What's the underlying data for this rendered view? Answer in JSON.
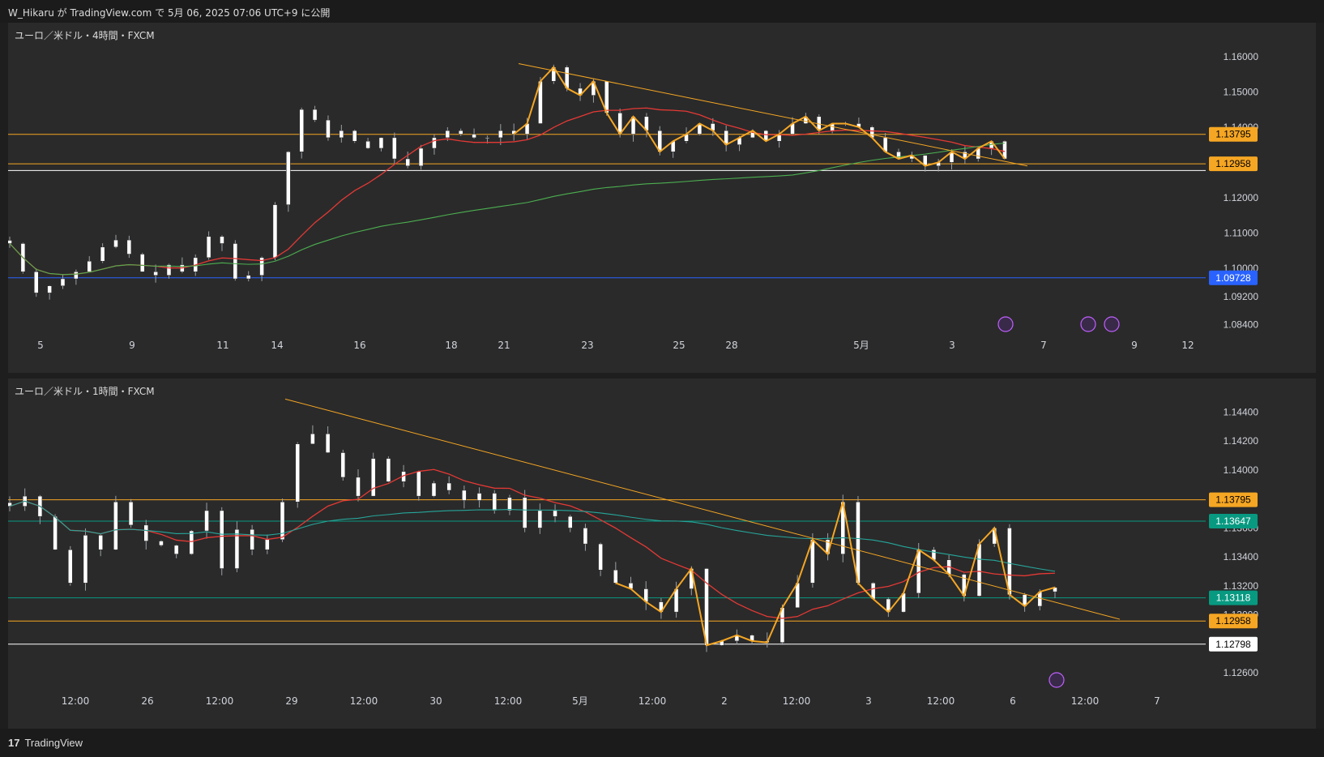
{
  "header": {
    "title": "W_Hikaru が TradingView.com で 5月 06, 2025 07:06 UTC+9 に公開"
  },
  "footer": {
    "brand": "TradingView",
    "logo_glyph": "17"
  },
  "colors": {
    "bg": "#2a2a2a",
    "up": "#ffffff",
    "down": "#ffffff",
    "wick": "#9aa0a6",
    "orange": "#f5a623",
    "red": "#e53935",
    "green": "#4caf50",
    "teal": "#26a69a",
    "blue": "#2962ff",
    "label_orange": "#f5a623",
    "label_teal": "#089981",
    "label_blue": "#2962ff",
    "label_white": "#ffffff"
  },
  "pane1": {
    "label": "ユーロ／米ドル・4時間・FXCM",
    "price_ticks": [
      "1.16000",
      "1.15000",
      "1.14000",
      "1.12000",
      "1.11000",
      "1.10000",
      "1.09200",
      "1.08400"
    ],
    "price_values": [
      1.16,
      1.15,
      1.14,
      1.12,
      1.11,
      1.1,
      1.092,
      1.084
    ],
    "time_ticks": [
      "5",
      "9",
      "11",
      "14",
      "16",
      "18",
      "21",
      "23",
      "25",
      "28",
      "5月",
      "3",
      "7",
      "9",
      "12"
    ],
    "levels": [
      {
        "price": 1.13795,
        "label": "1.13795",
        "color": "#f5a623",
        "textcolor": "#000000"
      },
      {
        "price": 1.12958,
        "label": "1.12958",
        "color": "#f5a623",
        "textcolor": "#000000"
      },
      {
        "price": 1.1277,
        "label": "",
        "color": "#ffffff",
        "textcolor": "#000000"
      },
      {
        "price": 1.09728,
        "label": "1.09728",
        "color": "#2962ff",
        "textcolor": "#ffffff"
      }
    ],
    "event_icons": [
      "lightning-icon",
      "us-flag-icon",
      "eu-flag-icon"
    ]
  },
  "pane2": {
    "label": "ユーロ／米ドル・1時間・FXCM",
    "price_ticks": [
      "1.14400",
      "1.14200",
      "1.14000",
      "1.13600",
      "1.13400",
      "1.13200",
      "1.13000",
      "1.12600"
    ],
    "price_values": [
      1.144,
      1.142,
      1.14,
      1.136,
      1.134,
      1.132,
      1.13,
      1.126
    ],
    "time_ticks": [
      "12:00",
      "26",
      "12:00",
      "29",
      "12:00",
      "30",
      "12:00",
      "5月",
      "12:00",
      "2",
      "12:00",
      "3",
      "12:00",
      "6",
      "12:00",
      "7"
    ],
    "levels": [
      {
        "price": 1.13795,
        "label": "1.13795",
        "color": "#f5a623",
        "textcolor": "#000000"
      },
      {
        "price": 1.13647,
        "label": "1.13647",
        "color": "#089981",
        "textcolor": "#ffffff"
      },
      {
        "price": 1.13118,
        "label": "1.13118",
        "color": "#089981",
        "textcolor": "#ffffff"
      },
      {
        "price": 1.12958,
        "label": "1.12958",
        "color": "#f5a623",
        "textcolor": "#000000"
      },
      {
        "price": 1.12798,
        "label": "1.12798",
        "color": "#ffffff",
        "textcolor": "#000000"
      }
    ],
    "event_icons": [
      "lightning-icon"
    ]
  },
  "chart_data": [
    {
      "type": "candlestick",
      "title": "ユーロ／米ドル・4時間・FXCM",
      "x": [
        "5",
        "9",
        "11",
        "14",
        "16",
        "18",
        "21",
        "23",
        "25",
        "28",
        "5月",
        "3",
        "7",
        "9",
        "12"
      ],
      "ylim": [
        1.08,
        1.165
      ],
      "close_path": [
        1.107,
        1.099,
        1.093,
        1.095,
        1.097,
        1.099,
        1.102,
        1.106,
        1.108,
        1.104,
        1.099,
        1.098,
        1.101,
        1.099,
        1.103,
        1.109,
        1.107,
        1.097,
        1.098,
        1.103,
        1.118,
        1.133,
        1.145,
        1.142,
        1.137,
        1.139,
        1.136,
        1.134,
        1.137,
        1.131,
        1.129,
        1.134,
        1.137,
        1.139,
        1.138,
        1.137,
        1.137,
        1.139,
        1.138,
        1.141,
        1.153,
        1.157,
        1.151,
        1.149,
        1.153,
        1.144,
        1.138,
        1.143,
        1.139,
        1.133,
        1.136,
        1.138,
        1.141,
        1.139,
        1.135,
        1.137,
        1.139,
        1.136,
        1.138,
        1.141,
        1.143,
        1.139,
        1.141,
        1.141,
        1.14,
        1.137,
        1.133,
        1.131,
        1.132,
        1.129,
        1.13,
        1.133,
        1.131,
        1.134,
        1.136,
        1.131
      ],
      "series": [
        {
          "name": "",
          "kind": "moving-average-red"
        },
        {
          "name": "",
          "kind": "moving-average-green"
        },
        {
          "name": "",
          "kind": "zigzag-orange"
        }
      ]
    },
    {
      "type": "candlestick",
      "title": "ユーロ／米ドル・1時間・FXCM",
      "x": [
        "12:00",
        "26",
        "12:00",
        "29",
        "12:00",
        "30",
        "12:00",
        "5月",
        "12:00",
        "2",
        "12:00",
        "3",
        "12:00",
        "6",
        "12:00",
        "7"
      ],
      "ylim": [
        1.1245,
        1.1452
      ],
      "close_path": [
        1.1375,
        1.1382,
        1.1368,
        1.1345,
        1.1322,
        1.1355,
        1.1345,
        1.1378,
        1.1362,
        1.1351,
        1.1348,
        1.1342,
        1.1358,
        1.1372,
        1.1332,
        1.1359,
        1.1345,
        1.1352,
        1.1378,
        1.1418,
        1.1425,
        1.1412,
        1.1395,
        1.1382,
        1.1408,
        1.1392,
        1.1399,
        1.1382,
        1.1391,
        1.1386,
        1.1379,
        1.1384,
        1.1372,
        1.1381,
        1.136,
        1.1372,
        1.1368,
        1.136,
        1.1349,
        1.1331,
        1.1322,
        1.1318,
        1.1309,
        1.1302,
        1.1318,
        1.1332,
        1.1279,
        1.1282,
        1.1286,
        1.1282,
        1.1281,
        1.1305,
        1.1322,
        1.1352,
        1.1342,
        1.1378,
        1.1322,
        1.1311,
        1.1302,
        1.1315,
        1.1345,
        1.1338,
        1.1328,
        1.1313,
        1.1349,
        1.136,
        1.1314,
        1.1306,
        1.1316,
        1.1319
      ],
      "series": [
        {
          "name": "",
          "kind": "moving-average-red"
        },
        {
          "name": "",
          "kind": "moving-average-teal"
        },
        {
          "name": "",
          "kind": "zigzag-orange"
        }
      ]
    }
  ]
}
